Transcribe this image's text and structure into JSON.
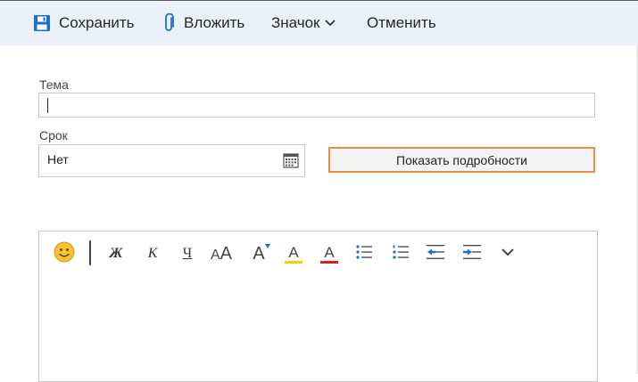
{
  "toolbar": {
    "save_label": "Сохранить",
    "attach_label": "Вложить",
    "badge_label": "Значок",
    "cancel_label": "Отменить"
  },
  "form": {
    "subject_label": "Тема",
    "subject_value": "",
    "due_label": "Срок",
    "due_value": "Нет",
    "details_button_label": "Показать подробности"
  },
  "editor": {
    "bold_glyph": "Ж",
    "italic_glyph": "К",
    "underline_glyph": "Ч",
    "font_size_glyph": "AA",
    "grow_font_glyph": "A",
    "highlight_glyph": "A",
    "font_color_glyph": "A",
    "body_text": ""
  },
  "colors": {
    "toolbar_bg": "#eaf1f9",
    "accent_blue": "#1e6fd0",
    "focus_orange": "#f08a3c",
    "highlight_yellow": "#f5d200",
    "font_red": "#e02020"
  },
  "icons": {
    "save": "save-icon",
    "attach": "paperclip-icon",
    "dropdown": "chevron-down-icon",
    "calendar": "calendar-icon",
    "emoji": "emoji-icon",
    "more": "chevron-down-icon"
  }
}
